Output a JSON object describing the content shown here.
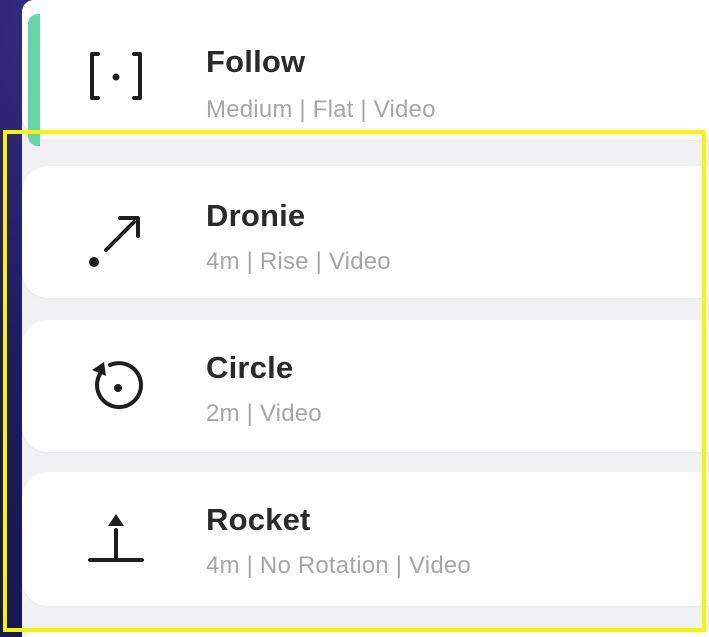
{
  "modes": [
    {
      "title": "Follow",
      "subtitle": "Medium | Flat | Video",
      "icon": "follow-bracket-icon",
      "selected": true
    },
    {
      "title": "Dronie",
      "subtitle": "4m | Rise | Video",
      "icon": "dronie-arrow-icon",
      "selected": false
    },
    {
      "title": "Circle",
      "subtitle": "2m | Video",
      "icon": "circle-orbit-icon",
      "selected": false
    },
    {
      "title": "Rocket",
      "subtitle": "4m | No Rotation | Video",
      "icon": "rocket-up-icon",
      "selected": false
    }
  ],
  "colors": {
    "selected_accent": "#66d6a6",
    "highlight_border": "#f6f600",
    "background": "#1d1a5e"
  }
}
